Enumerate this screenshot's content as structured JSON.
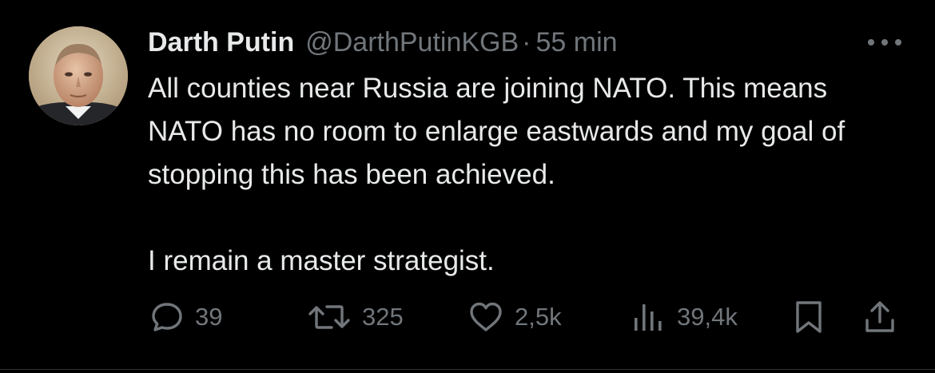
{
  "tweet": {
    "author": {
      "display_name": "Darth Putin",
      "handle": "@DarthPutinKGB",
      "separator": "·",
      "timestamp": "55 min",
      "avatar_icon": "avatar-portrait"
    },
    "text": {
      "line1": "All counties near Russia are joining NATO. This means NATO has no room to enlarge eastwards and my goal of stopping this has been achieved.",
      "line2": "I remain a master strategist."
    },
    "actions": {
      "reply": {
        "icon": "speech-bubble-icon",
        "count": "39"
      },
      "retweet": {
        "icon": "retweet-arrows-icon",
        "count": "325"
      },
      "like": {
        "icon": "heart-icon",
        "count": "2,5k"
      },
      "views": {
        "icon": "bar-chart-icon",
        "count": "39,4k"
      },
      "bookmark": {
        "icon": "bookmark-icon"
      },
      "share": {
        "icon": "share-upload-icon"
      }
    },
    "more_icon": "more-horizontal-icon"
  },
  "colors": {
    "background": "#000000",
    "primary_text": "#e7e9ea",
    "secondary_text": "#71767b",
    "divider": "#2f3336"
  }
}
